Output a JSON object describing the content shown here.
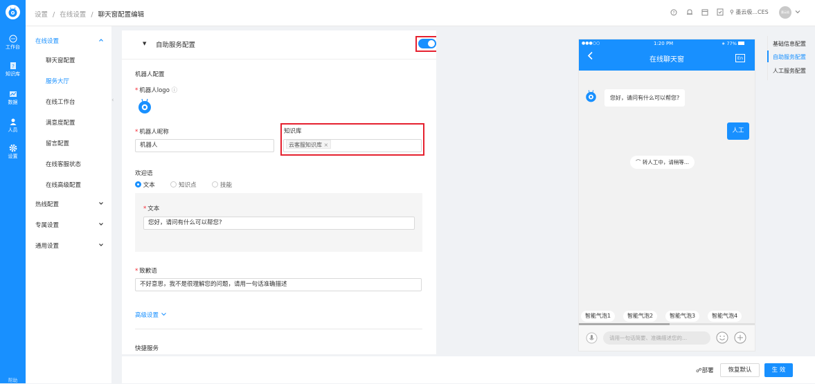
{
  "rail": {
    "items": [
      {
        "label": "工作台",
        "icon": "chat-icon"
      },
      {
        "label": "知识库",
        "icon": "book-icon"
      },
      {
        "label": "数据",
        "icon": "chart-icon"
      },
      {
        "label": "人员",
        "icon": "user-icon"
      },
      {
        "label": "设置",
        "icon": "gear-icon"
      }
    ],
    "bottom_label": "帮助"
  },
  "header": {
    "breadcrumb": [
      "设置",
      "在线设置",
      "聊天窗配置编辑"
    ],
    "separator": "/",
    "user_name": "墨云极...CES",
    "avatar_text": "墨云极"
  },
  "menu": {
    "groups": [
      {
        "label": "在线设置",
        "expanded": true,
        "items": [
          "聊天窗配置",
          "服务大厅",
          "在线工作台",
          "满意度配置",
          "留言配置",
          "在线客服状态",
          "在线高级配置"
        ]
      },
      {
        "label": "热线配置"
      },
      {
        "label": "专属设置"
      },
      {
        "label": "通用设置"
      }
    ]
  },
  "form": {
    "section_title": "自助服务配置",
    "robot_config_title": "机器人配置",
    "logo_label": "机器人logo",
    "nickname_label": "机器人昵称",
    "nickname_value": "机器人",
    "kb_label": "知识库",
    "kb_tag": "云客服知识库",
    "kb_tag_close": "×",
    "welcome_label": "欢迎语",
    "welcome_options": [
      "文本",
      "知识点",
      "技能"
    ],
    "text_label": "文本",
    "text_value": "您好，请问有什么可以帮您?",
    "apology_label": "致歉语",
    "apology_value": "不好意思，我不是很理解您的问题，请用一句话准确描述",
    "advanced_label": "高级设置",
    "quick_label": "快捷服务"
  },
  "phone": {
    "status_left": "●●●○○",
    "time": "1:20 PM",
    "battery": "77%",
    "title": "在线聊天窗",
    "lang_btn": "En",
    "bot_msg": "您好，请问有什么可以帮您?",
    "user_msg": "人工",
    "transfer_msg": "转人工中，请稍等...",
    "chips": [
      "智能气泡1",
      "智能气泡2",
      "智能气泡3",
      "智能气泡4"
    ],
    "input_placeholder": "请用一句话简要、准确描述您的..."
  },
  "anchor": {
    "items": [
      "基础信息配置",
      "自助服务配置",
      "人工服务配置"
    ],
    "active": 1
  },
  "footer": {
    "deploy": "部署",
    "reset": "恢复默认",
    "submit": "生 效"
  },
  "colors": {
    "primary": "#1890ff",
    "highlight": "#e5202e",
    "required": "#f5222d"
  }
}
